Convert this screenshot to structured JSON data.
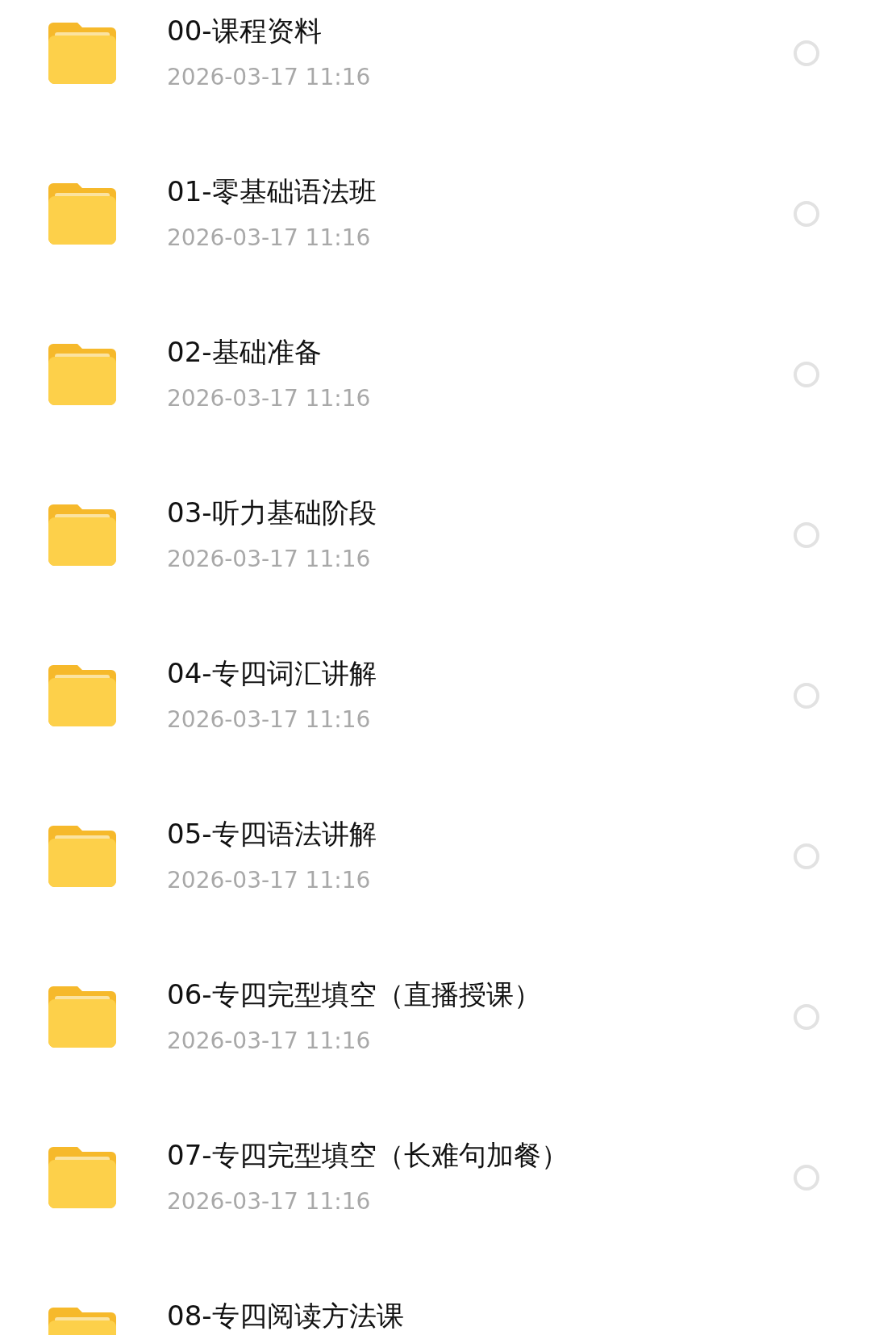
{
  "files": [
    {
      "name": "00-课程资料",
      "date": "2026-03-17 11:16",
      "selected": false
    },
    {
      "name": "01-零基础语法班",
      "date": "2026-03-17 11:16",
      "selected": false
    },
    {
      "name": "02-基础准备",
      "date": "2026-03-17 11:16",
      "selected": false
    },
    {
      "name": "03-听力基础阶段",
      "date": "2026-03-17 11:16",
      "selected": false
    },
    {
      "name": "04-专四词汇讲解",
      "date": "2026-03-17 11:16",
      "selected": false
    },
    {
      "name": "05-专四语法讲解",
      "date": "2026-03-17 11:16",
      "selected": false
    },
    {
      "name": "06-专四完型填空（直播授课）",
      "date": "2026-03-17 11:16",
      "selected": false
    },
    {
      "name": "07-专四完型填空（长难句加餐）",
      "date": "2026-03-17 11:16",
      "selected": false
    },
    {
      "name": "08-专四阅读方法课"
    }
  ]
}
